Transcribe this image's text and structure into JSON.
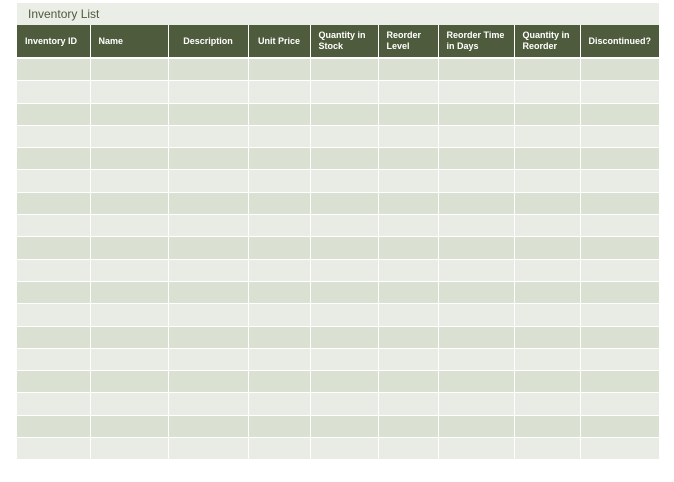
{
  "title": "Inventory List",
  "columns": [
    "Inventory ID",
    "Name",
    "Description",
    "Unit Price",
    "Quantity in Stock",
    "Reorder Level",
    "Reorder Time in Days",
    "Quantity in Reorder",
    "Discontinued?"
  ],
  "row_count": 18,
  "colors": {
    "header": "#4f5b3d",
    "row_dark": "#dae0d2",
    "row_light": "#e9ece5",
    "title_band": "#ebede7"
  }
}
